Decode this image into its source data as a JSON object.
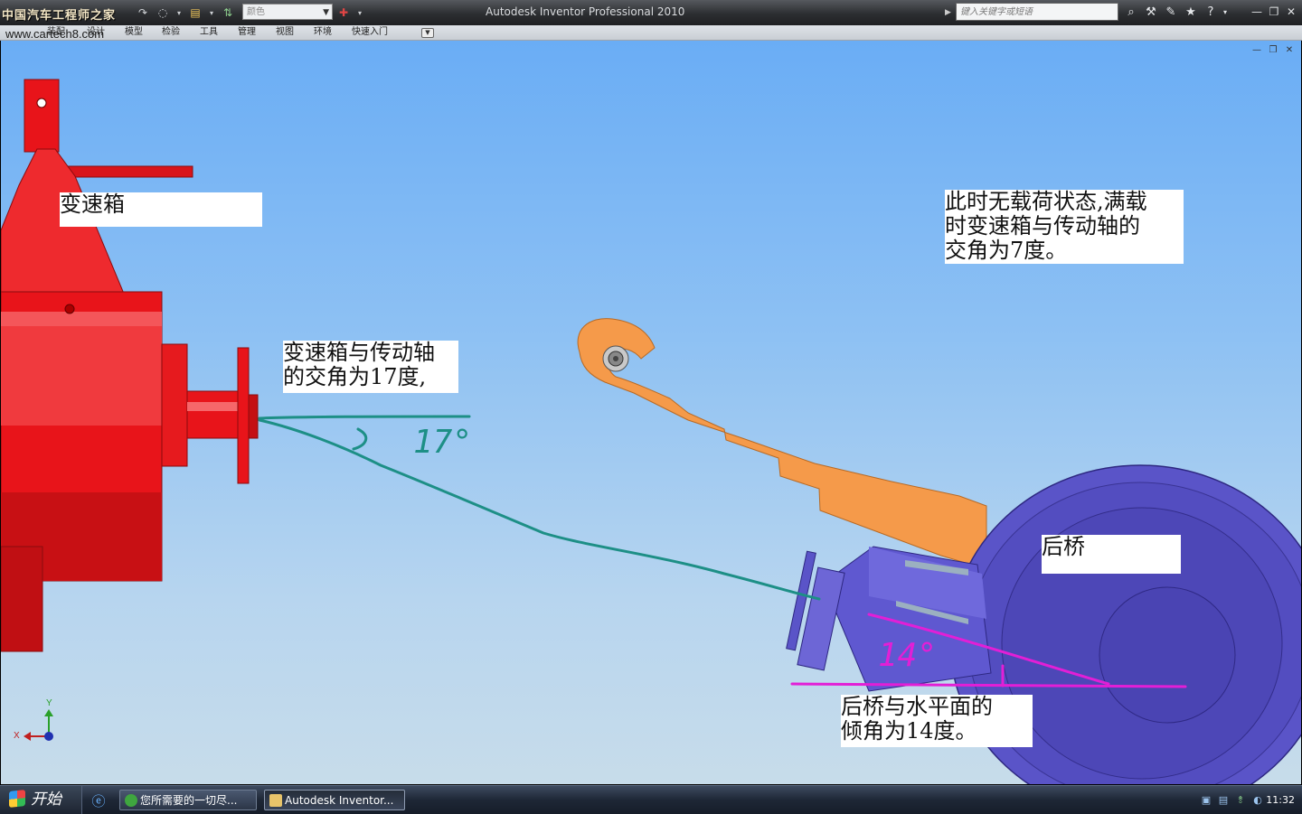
{
  "titlebar": {
    "logo_text": "中国汽车工程师之家",
    "color_dropdown": "颜色",
    "app_title": "Autodesk Inventor Professional 2010",
    "search_placeholder": "键入关键字或短语"
  },
  "ribbon": {
    "tabs": [
      "装配",
      "设计",
      "模型",
      "检验",
      "工具",
      "管理",
      "视图",
      "环境",
      "快速入门"
    ],
    "watermark": "www.cartech8.com"
  },
  "viewport": {
    "labels": {
      "gearbox": "变速箱",
      "note_top": "此时无载荷状态,满载\n时变速箱与传动轴的\n交角为7度。",
      "angle_gearbox": "变速箱与传动轴\n的交角为17度,",
      "rear_axle": "后桥",
      "angle_axle": "后桥与水平面的\n倾角为14度。"
    },
    "sketch": {
      "angle17": "17°",
      "angle14": "14°"
    },
    "axis": {
      "x": "X",
      "y": "Y"
    },
    "colors": {
      "gearbox": "#e8141a",
      "leaf_spring": "#f59a4a",
      "axle": "#5147b8",
      "annotation_teal": "#1d8f86",
      "annotation_magenta": "#e21fd6"
    }
  },
  "taskbar": {
    "start_label": "开始",
    "tasks": [
      {
        "label": "您所需要的一切尽...",
        "icon": "browser-icon"
      },
      {
        "label": "Autodesk Inventor...",
        "icon": "inventor-icon"
      }
    ],
    "clock": "11:32"
  }
}
